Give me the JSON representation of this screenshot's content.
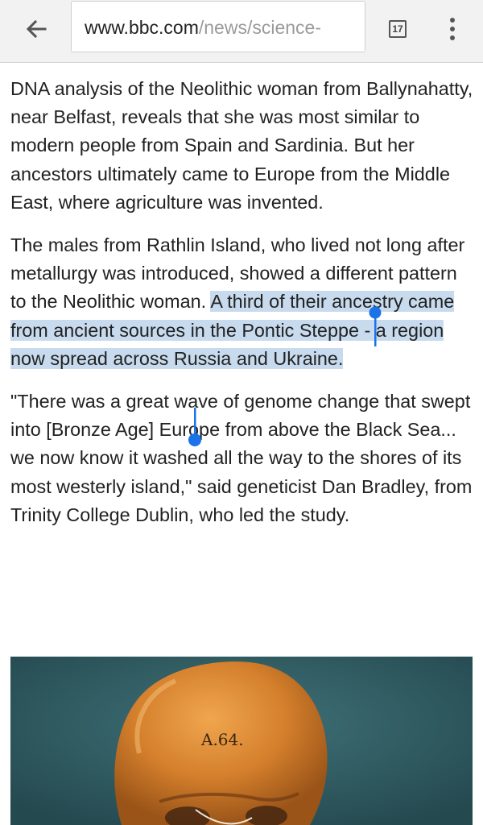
{
  "toolbar": {
    "back_icon": "arrow-left-icon",
    "url": {
      "host": "www.bbc.com",
      "path": "/news/science-"
    },
    "tab_count": "17",
    "menu_icon": "more-vert-icon"
  },
  "article": {
    "paragraph_1": "DNA analysis of the Neolithic woman from Ballynahatty, near Belfast, reveals that she was most similar to modern people from Spain and Sardinia. But her ancestors ultimately came to Europe from the Middle East, where agriculture was invented.",
    "paragraph_2_before": "The males from Rathlin Island, who lived not long after metallurgy was introduced, showed a different pattern to the Neolithic woman. ",
    "paragraph_2_selected": "A third of their ancestry came from ancient sources in the Pontic Steppe - a region now spread across Russia and Ukraine.",
    "paragraph_3": "\"There was a great wave of genome change that swept into [Bronze Age] Europe from above the Black Sea... we now know it washed all the way to the shores of its most westerly island,\" said geneticist Dan Bradley, from Trinity College Dublin, who led the study.",
    "image": {
      "skull_label": "A.64."
    }
  },
  "colors": {
    "selection": "#c8dbee",
    "handle": "#1a73e8",
    "toolbar_bg": "#f2f2f2"
  }
}
